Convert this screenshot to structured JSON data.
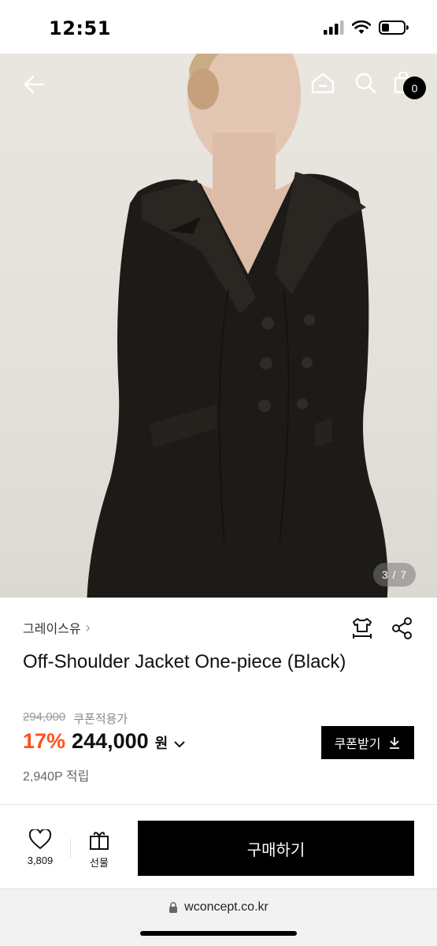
{
  "status_bar": {
    "time": "12:51"
  },
  "hero": {
    "image_counter": "3 / 7",
    "cart_count": "0",
    "icons": [
      "back-arrow-icon",
      "home-icon",
      "search-icon",
      "shopping-bag-icon"
    ]
  },
  "product": {
    "brand": "그레이스유",
    "name": "Off-Shoulder Jacket One-piece (Black)",
    "original_price": "294,000",
    "coupon_note": "쿠폰적용가",
    "discount": "17%",
    "price": "244,000",
    "currency": "원",
    "coupon_button": "쿠폰받기",
    "points": "2,940P 적립",
    "info_icons": [
      "size-guide-icon",
      "share-icon"
    ]
  },
  "actions": {
    "like_count": "3,809",
    "gift_label": "선물",
    "buy_label": "구매하기"
  },
  "browser": {
    "url": "wconcept.co.kr"
  },
  "colors": {
    "discount": "#ff4f1f",
    "button": "#000000"
  }
}
